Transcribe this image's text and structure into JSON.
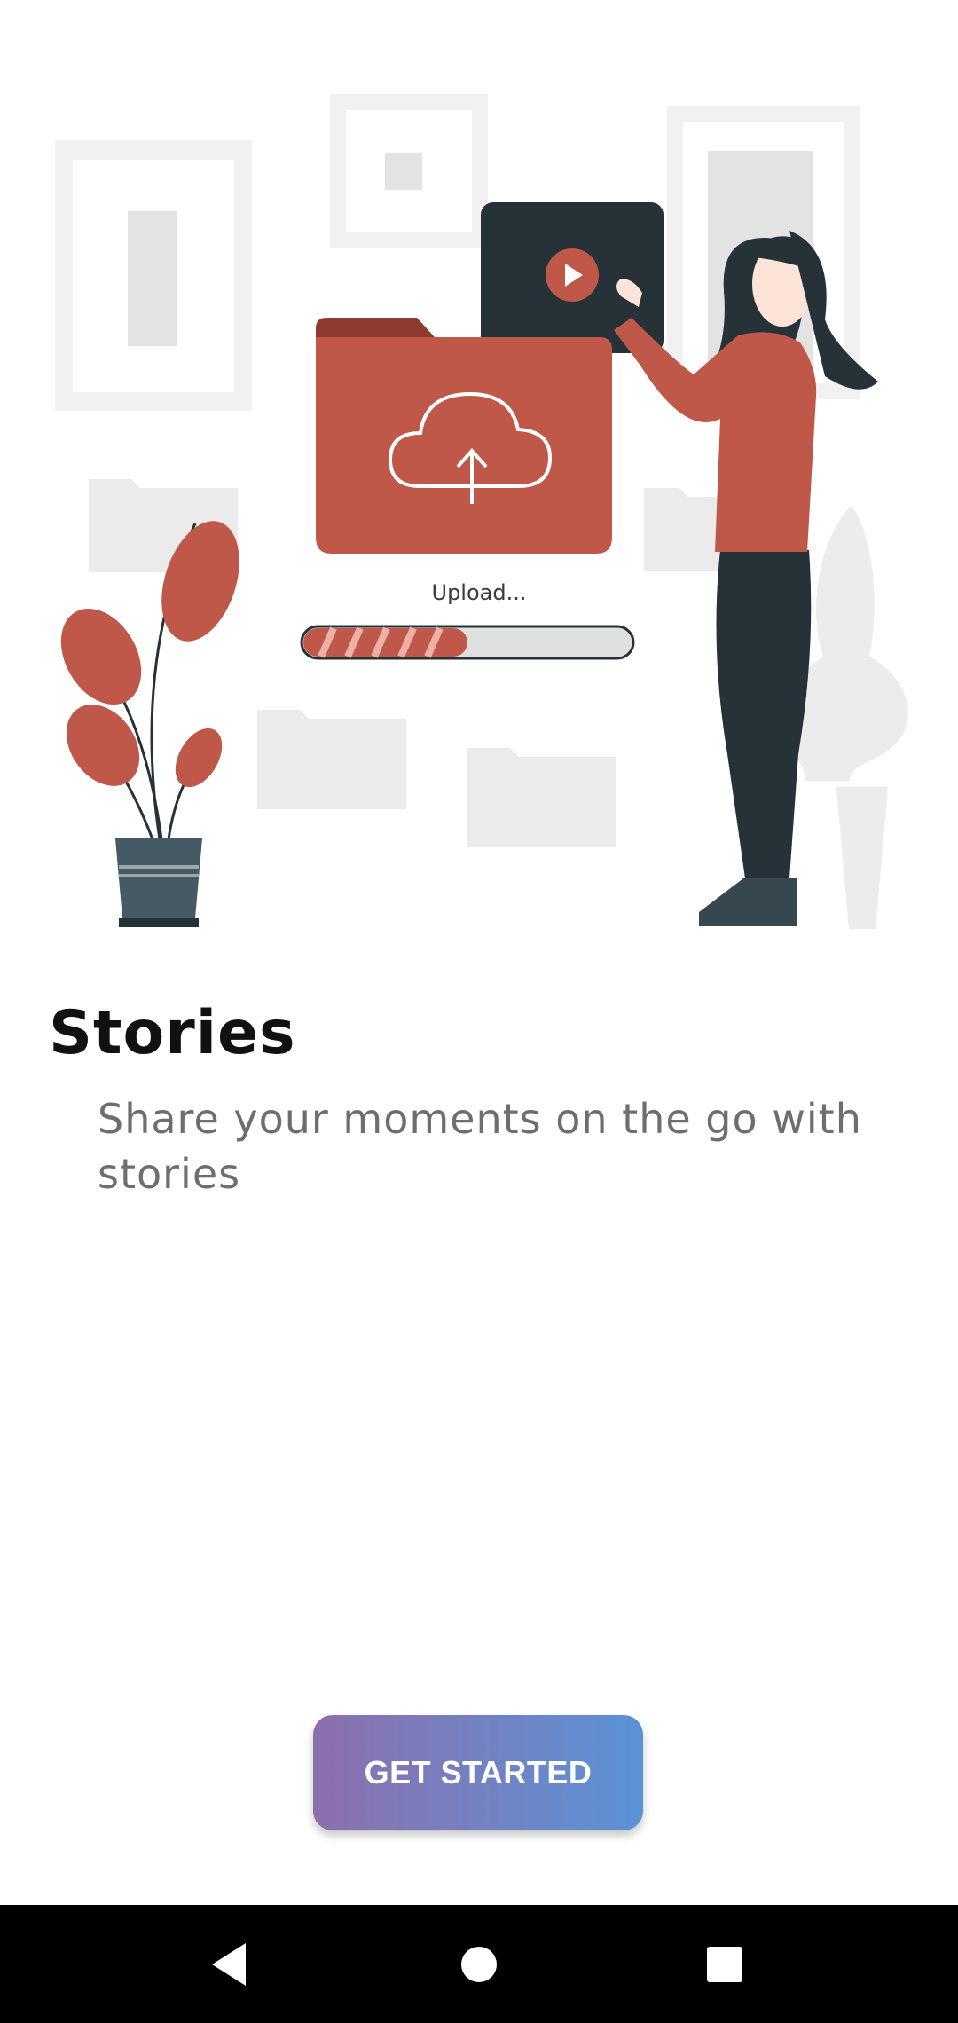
{
  "illustration": {
    "upload_label": "Upload...",
    "upload_progress": 0.5,
    "accent_color": "#c0584a",
    "dark_color": "#263238",
    "ghost_color": "#ebebeb"
  },
  "onboarding": {
    "title": "Stories",
    "description": "Share your moments on the go with stories"
  },
  "cta": {
    "label": "GET STARTED",
    "gradient_start": "#8c6fad",
    "gradient_end": "#5a92d6"
  },
  "navbar": {
    "icons": [
      "back-icon",
      "home-icon",
      "recents-icon"
    ]
  }
}
